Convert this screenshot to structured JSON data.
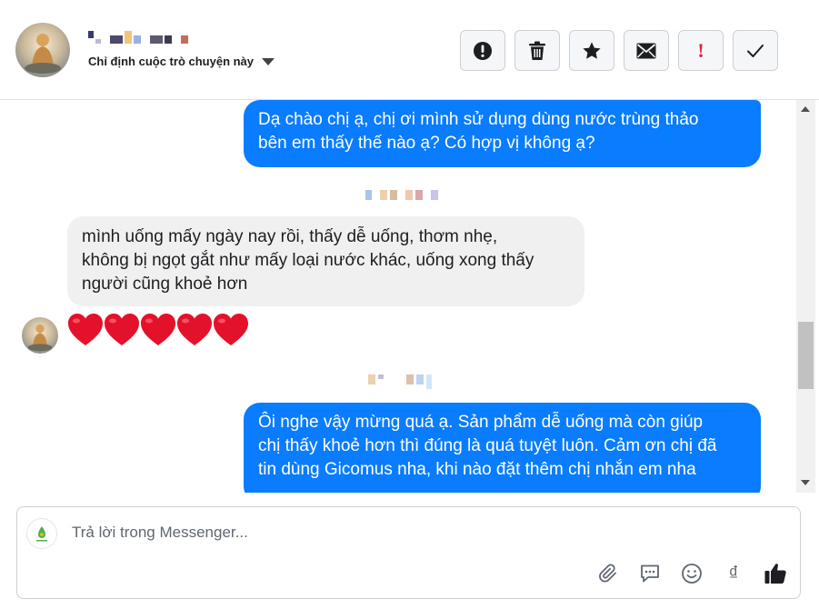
{
  "header": {
    "contact_name": "",
    "assign_label": "Chỉ định cuộc trò chuyện này",
    "actions": [
      {
        "name": "spam",
        "icon": "exclamation-circle-icon"
      },
      {
        "name": "delete",
        "icon": "trash-icon"
      },
      {
        "name": "star",
        "icon": "star-icon"
      },
      {
        "name": "mark-unread",
        "icon": "envelope-icon"
      },
      {
        "name": "follow-up",
        "icon": "exclamation-icon",
        "label": "!"
      },
      {
        "name": "done",
        "icon": "check-icon"
      }
    ]
  },
  "messages": [
    {
      "direction": "outgoing",
      "text_lines": [
        "Dạ chào chị ạ, chị ơi mình sử dụng dùng nước trùng thảo",
        "bên em thấy thế nào ạ? Có hợp vị không ạ?"
      ]
    },
    {
      "direction": "incoming",
      "text_lines": [
        "mình uống mấy ngày nay rồi, thấy dễ uống, thơm nhẹ,",
        "không bị ngọt gắt như mấy loại nước khác, uống xong thấy",
        "người cũng khoẻ hơn"
      ]
    },
    {
      "direction": "incoming",
      "text": "❤❤❤❤❤",
      "icon": "heart-emoji"
    },
    {
      "direction": "outgoing",
      "text_lines": [
        "Ôi nghe vậy mừng quá ạ. Sản phẩm dễ uống mà còn giúp",
        "chị thấy khoẻ hơn thì đúng là quá tuyệt luôn. Cảm ơn chị đã",
        "tin dùng Gicomus nha, khi nào đặt thêm chị nhắn em nha"
      ]
    }
  ],
  "composer": {
    "placeholder": "Trả lời trong Messenger...",
    "tools": [
      "paperclip-icon",
      "chat-bubble-icon",
      "smiley-icon",
      "dong-icon",
      "thumbs-up-icon"
    ],
    "currency_symbol": "₫"
  },
  "colors": {
    "outgoing_bubble": "#0a7cff",
    "incoming_bubble": "#f0f0f0",
    "heart": "#e3122a",
    "follow_up_red": "#e41e3f"
  }
}
